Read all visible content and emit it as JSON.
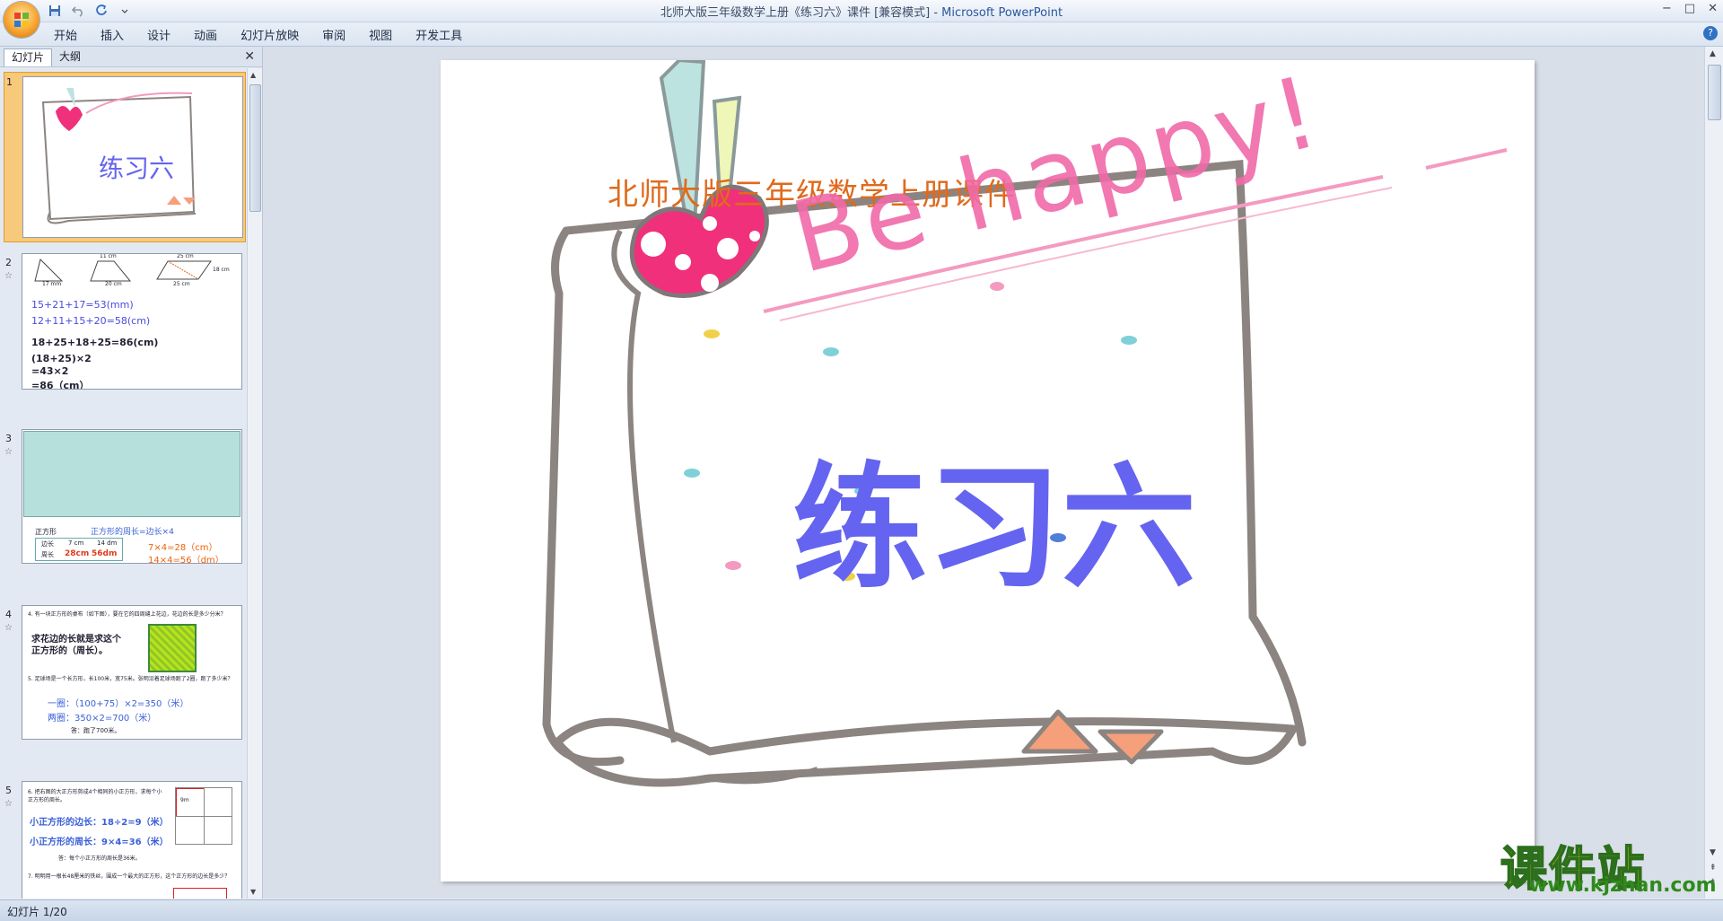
{
  "window": {
    "title_doc": "北师大版三年级数学上册《练习六》课件 [兼容模式] - ",
    "title_app": "Microsoft PowerPoint",
    "controls": [
      "−",
      "□",
      "✕"
    ]
  },
  "menu": {
    "tabs": [
      "开始",
      "插入",
      "设计",
      "动画",
      "幻灯片放映",
      "审阅",
      "视图",
      "开发工具"
    ],
    "help": "?"
  },
  "left_panel": {
    "tabs": [
      "幻灯片",
      "大纲"
    ],
    "close": "✕",
    "slides": [
      {
        "num": "1",
        "mini_title": "练习六"
      },
      {
        "num": "2",
        "star": "☆",
        "lines": [
          "15+21+17=53(mm)",
          "12+11+15+20=58(cm)",
          "18+25+18+25=86(cm)",
          "(18+25)×2",
          "=43×2",
          "=86（cm）"
        ],
        "labels": [
          "17 mm",
          "11 cm",
          "20 cm",
          "25 cm",
          "25 cm",
          "18 cm"
        ]
      },
      {
        "num": "3",
        "star": "☆",
        "label": "正方形",
        "formula": "正方形的周长=边长×4",
        "table": [
          [
            "边长",
            "7 cm",
            "14 dm"
          ],
          [
            "周长",
            "28cm",
            "56dm"
          ]
        ],
        "answers": [
          "7×4=28（cm）",
          "14×4=56（dm）"
        ]
      },
      {
        "num": "4",
        "star": "☆",
        "q1": "4. 有一块正方形的桌布（如下图），要在它的四周缝上花边，花边的长是多少分米？",
        "hint1": "求花边的长就是求这个",
        "hint2": "正方形的（周长）。",
        "q2": "5. 足球场是一个长方形，长100米，宽75米。张明沿着足球场跑了2圈，跑了多少米？",
        "a1": "一圈：（100+75）×2=350（米）",
        "a2": "两圈：350×2=700（米）",
        "ans": "答：跑了700米。"
      },
      {
        "num": "5",
        "star": "☆",
        "q1": "6. 把右图的大正方形剪成4个相同的小正方形，求每个小正方形的周长。",
        "l1": "小正方形的边长：18÷2=9（米）",
        "l2": "小正方形的周长：9×4=36（米）",
        "ans": "答：每个小正方形的周长是36米。",
        "q2": "7. 明明用一根长48厘米的铁丝，围成一个最大的正方形，这个正方形的边长是多少？",
        "grid_label": "9m"
      }
    ]
  },
  "slide": {
    "subtitle": "北师大版三年级数学上册课件",
    "title": "练习六",
    "decor_text": "Be happy!"
  },
  "status": {
    "text": "幻灯片 1/20"
  },
  "watermark": {
    "title": "课件站",
    "url": "www.kjzhan.com"
  },
  "colors": {
    "accent": "#2b579a",
    "slide_title": "#6464f0",
    "slide_subtitle": "#e06a1c",
    "selected_slide": "#f7c97a"
  }
}
